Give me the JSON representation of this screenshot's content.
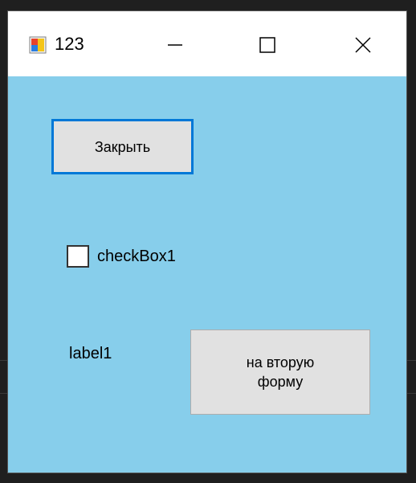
{
  "window": {
    "title": "123",
    "icon": "app-icon",
    "background_color": "#87ceeb"
  },
  "title_controls": {
    "minimize_icon": "minimize-icon",
    "maximize_icon": "maximize-icon",
    "close_icon": "close-icon"
  },
  "form": {
    "close_button_label": "Закрыть",
    "checkbox_label": "checkBox1",
    "checkbox_checked": false,
    "label1_text": "label1",
    "second_form_button_label": "на вторую форму"
  },
  "colors": {
    "focus_border": "#0078d7",
    "button_face": "#e1e1e1"
  }
}
